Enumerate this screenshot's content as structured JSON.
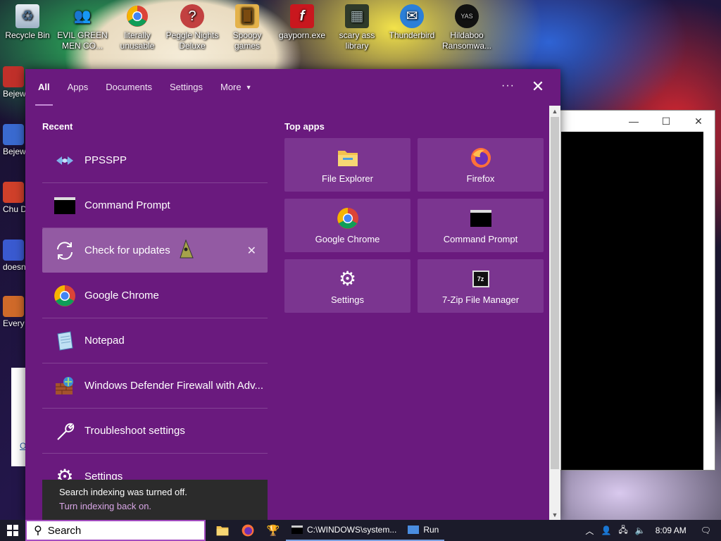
{
  "desktop": {
    "icons": [
      {
        "label": "Recycle Bin",
        "icon": "recycle-bin-icon"
      },
      {
        "label": "EVIL GREEN MEN CO...",
        "icon": "users-icon"
      },
      {
        "label": "literally unusable",
        "icon": "chrome-icon"
      },
      {
        "label": "Peggle Nights Deluxe",
        "icon": "peggle-icon"
      },
      {
        "label": "Spoopy games",
        "icon": "folder-icon"
      },
      {
        "label": "gayporn.exe",
        "icon": "flash-icon"
      },
      {
        "label": "scary ass library",
        "icon": "library-icon"
      },
      {
        "label": "Thunderbird",
        "icon": "thunderbird-icon"
      },
      {
        "label": "Hildaboo Ransomwa...",
        "icon": "ransomware-icon"
      }
    ],
    "left_icons": [
      {
        "label": "Bejew Del"
      },
      {
        "label": "Bejew Del"
      },
      {
        "label": "Chu Del"
      },
      {
        "label": "doesn"
      },
      {
        "label": "Every"
      }
    ],
    "background_window_link": "O"
  },
  "search_panel": {
    "tabs": [
      {
        "label": "All",
        "active": true
      },
      {
        "label": "Apps"
      },
      {
        "label": "Documents"
      },
      {
        "label": "Settings"
      },
      {
        "label": "More"
      }
    ],
    "dots_label": "···",
    "close_label": "✕",
    "recent_heading": "Recent",
    "recent_items": [
      {
        "label": "PPSSPP",
        "icon": "ppsspp-icon"
      },
      {
        "label": "Command Prompt",
        "icon": "command-prompt-icon"
      },
      {
        "label": "Check for updates",
        "icon": "sync-icon",
        "highlight": true
      },
      {
        "label": "Google Chrome",
        "icon": "chrome-icon"
      },
      {
        "label": "Notepad",
        "icon": "notepad-icon"
      },
      {
        "label": "Windows Defender Firewall with Adv...",
        "icon": "firewall-icon"
      },
      {
        "label": "Troubleshoot settings",
        "icon": "wrench-icon"
      },
      {
        "label": "Settings",
        "icon": "gear-icon"
      }
    ],
    "top_apps_heading": "Top apps",
    "top_apps": [
      {
        "label": "File Explorer",
        "icon": "file-explorer-icon"
      },
      {
        "label": "Firefox",
        "icon": "firefox-icon"
      },
      {
        "label": "Google Chrome",
        "icon": "chrome-icon"
      },
      {
        "label": "Command Prompt",
        "icon": "command-prompt-icon"
      },
      {
        "label": "Settings",
        "icon": "gear-icon"
      },
      {
        "label": "7-Zip File Manager",
        "icon": "7zip-icon"
      }
    ],
    "toast": {
      "message": "Search indexing was turned off.",
      "action": "Turn indexing back on."
    }
  },
  "taskbar": {
    "search_placeholder": "Search",
    "cmd_window_label": "C:\\WINDOWS\\system...",
    "run_window_label": "Run",
    "clock": "8:09 AM"
  },
  "colors": {
    "panel_bg": "#6a1a7e",
    "tile_bg": "#7b3590",
    "highlight_bg": "#935aa3",
    "accent": "#c58cd6"
  }
}
